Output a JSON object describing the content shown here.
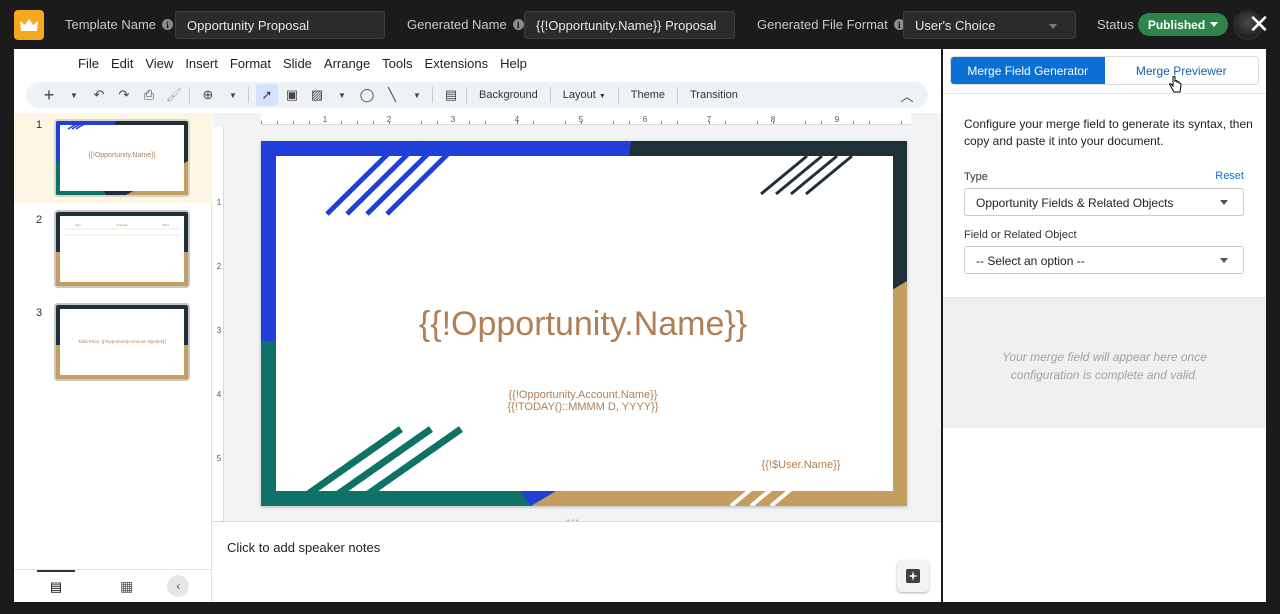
{
  "topbar": {
    "template_name_label": "Template Name",
    "template_name_value": "Opportunity Proposal",
    "generated_name_label": "Generated Name",
    "generated_name_value": "{{!Opportunity.Name}} Proposal",
    "generated_format_label": "Generated File Format",
    "generated_format_value": "User's Choice",
    "status_label": "Status",
    "status_value": "Published"
  },
  "menu": [
    "File",
    "Edit",
    "View",
    "Insert",
    "Format",
    "Slide",
    "Arrange",
    "Tools",
    "Extensions",
    "Help"
  ],
  "toolbar": {
    "background": "Background",
    "layout": "Layout",
    "theme": "Theme",
    "transition": "Transition"
  },
  "slides": [
    {
      "number": "1",
      "title": "{{!Opportunity.Name}}"
    },
    {
      "number": "2",
      "headers": [
        "Item",
        "Quantity",
        "Price"
      ]
    },
    {
      "number": "3",
      "text": "Total Price: {{!Opportunity.Amount::Symbol}}"
    }
  ],
  "ruler": {
    "h_ticks": [
      "1",
      "2",
      "3",
      "4",
      "5",
      "6",
      "7",
      "8",
      "9"
    ],
    "v_ticks": [
      "1",
      "2",
      "3",
      "4",
      "5"
    ]
  },
  "slide_main": {
    "title": "{{!Opportunity.Name}}",
    "sub1": "{{!Opportunity.Account.Name}}",
    "sub2": "{{!TODAY()::MMMM D, YYYY}}",
    "footer": "{{!$User.Name}}"
  },
  "notes": {
    "placeholder": "Click to add speaker notes"
  },
  "panel": {
    "tab_generator": "Merge Field Generator",
    "tab_previewer": "Merge Previewer",
    "description": "Configure your merge field to generate its syntax, then copy and paste it into your document.",
    "type_label": "Type",
    "reset": "Reset",
    "type_value": "Opportunity Fields & Related Objects",
    "field_label": "Field or Related Object",
    "field_value": "-- Select an option --",
    "result_text": "Your merge field will appear here once configuration is complete and valid."
  },
  "colors": {
    "blue": "#1f3fd8",
    "teal": "#0f7266",
    "gold": "#c59d5f",
    "dark": "#1f3038",
    "title": "#b07f55",
    "accent": "#0b6fd6",
    "published": "#2e844a"
  }
}
